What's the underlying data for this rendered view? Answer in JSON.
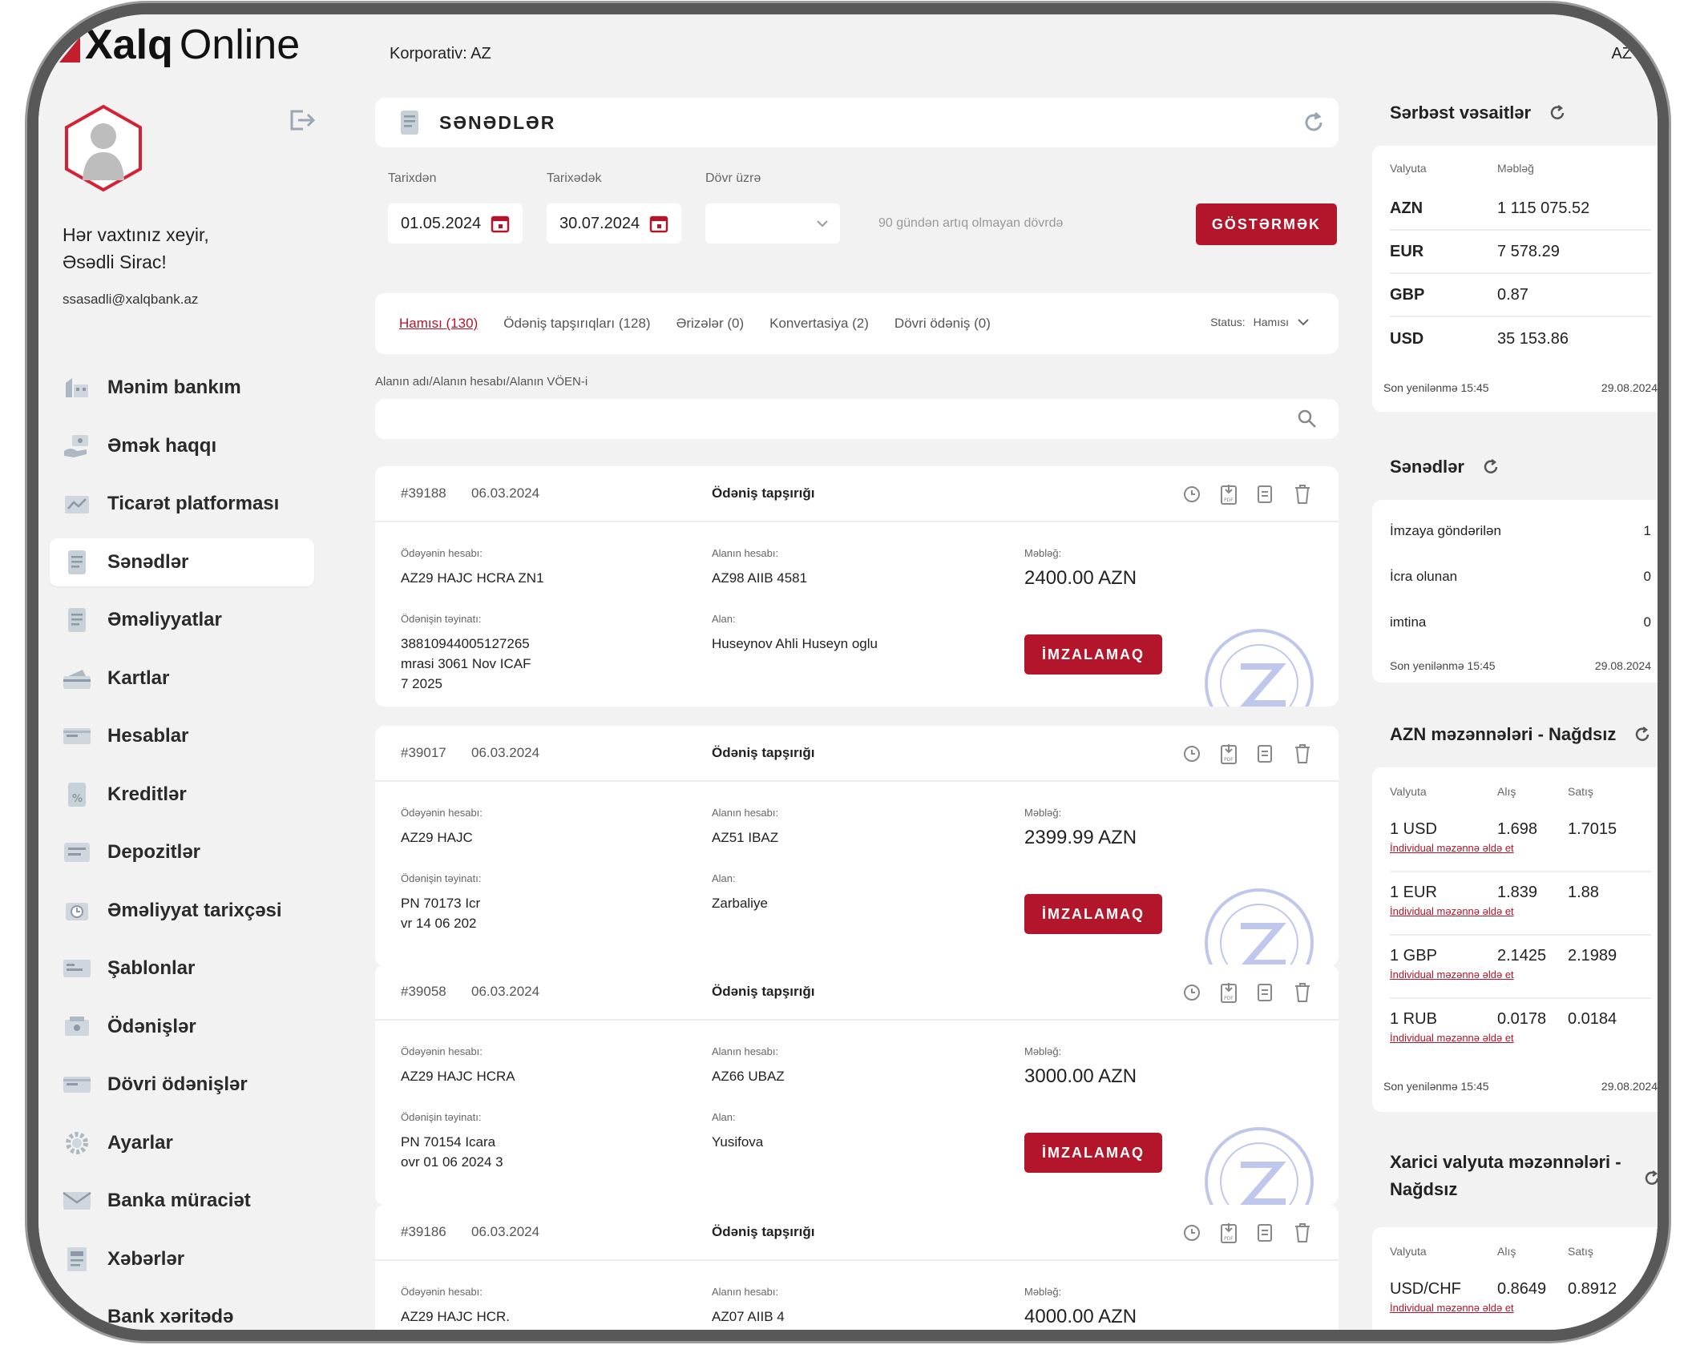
{
  "header": {
    "logo_bold": "Xalq",
    "logo_light": "Online",
    "corporate": "Korporativ: AZ",
    "lang": "AZ"
  },
  "sidebar": {
    "greeting_line1": "Hər vaxtınız xeyir,",
    "greeting_line2": "Əsədli Sirac!",
    "email": "ssasadli@xalqbank.az",
    "items": [
      {
        "label": "Mənim bankım",
        "icon": "bank-icon"
      },
      {
        "label": "Əmək haqqı",
        "icon": "salary-icon"
      },
      {
        "label": "Ticarət platforması",
        "icon": "trade-platform-icon"
      },
      {
        "label": "Sənədlər",
        "icon": "documents-icon"
      },
      {
        "label": "Əməliyyatlar",
        "icon": "operations-icon"
      },
      {
        "label": "Kartlar",
        "icon": "card-icon"
      },
      {
        "label": "Hesablar",
        "icon": "accounts-icon"
      },
      {
        "label": "Kreditlər",
        "icon": "credit-icon"
      },
      {
        "label": "Depozitlər",
        "icon": "deposit-icon"
      },
      {
        "label": "Əməliyyat tarixçəsi",
        "icon": "history-icon"
      },
      {
        "label": "Şablonlar",
        "icon": "template-icon"
      },
      {
        "label": "Ödənişlər",
        "icon": "payment-icon"
      },
      {
        "label": "Dövri ödənişlər",
        "icon": "recurring-payment-icon"
      },
      {
        "label": "Ayarlar",
        "icon": "gear-icon"
      },
      {
        "label": "Banka müraciət",
        "icon": "mail-icon"
      },
      {
        "label": "Xəbərlər",
        "icon": "news-icon"
      },
      {
        "label": "Bank xəritədə",
        "icon": "map-pin-icon"
      }
    ],
    "active_index": 3
  },
  "main": {
    "title": "SƏNƏDLƏR",
    "filters": {
      "from_label": "Tarixdən",
      "from_value": "01.05.2024",
      "to_label": "Tarixədək",
      "to_value": "30.07.2024",
      "period_label": "Dövr üzrə",
      "period_value": "",
      "hint": "90 gündən artıq olmayan dövrdə",
      "show_button": "GÖSTƏRMƏK"
    },
    "tabs": [
      {
        "label": "Hamısı (130)"
      },
      {
        "label": "Ödəniş tapşırıqları (128)"
      },
      {
        "label": "Ərizələr (0)"
      },
      {
        "label": "Konvertasiya (2)"
      },
      {
        "label": "Dövri ödəniş (0)"
      }
    ],
    "status_label": "Status:",
    "status_value": "Hamısı",
    "search_label": "Alanın adı/Alanın hesabı/Alanın VÖEN-i",
    "search_placeholder": "",
    "doc_labels": {
      "payer_account": "Ödəyənin hesabı:",
      "receiver_account": "Alanın hesabı:",
      "amount": "Məbləğ:",
      "purpose": "Ödənişin təyinatı:",
      "receiver": "Alan:",
      "sign": "İMZALAMAQ"
    },
    "documents": [
      {
        "number": "#39188",
        "date": "06.03.2024",
        "type": "Ödəniş tapşırığı",
        "payer_account": "AZ29 HAJC HCRA ZN1",
        "receiver_account": "AZ98 AIIB 4581",
        "amount": "2400.00 AZN",
        "purpose_1": "38810944005127265",
        "purpose_2": "mrasi 3061 Nov ICAF",
        "purpose_3": "7 2025",
        "receiver": "Huseynov Ahli Huseyn oglu"
      },
      {
        "number": "#39017",
        "date": "06.03.2024",
        "type": "Ödəniş tapşırığı",
        "payer_account": "AZ29 HAJC",
        "receiver_account": "AZ51 IBAZ",
        "amount": "2399.99 AZN",
        "purpose_1": "PN 70173 Icr",
        "purpose_2": "vr 14 06 202",
        "purpose_3": "",
        "receiver": "Zarbaliye"
      },
      {
        "number": "#39058",
        "date": "06.03.2024",
        "type": "Ödəniş tapşırığı",
        "payer_account": "AZ29 HAJC HCRA",
        "receiver_account": "AZ66 UBAZ",
        "amount": "3000.00 AZN",
        "purpose_1": "PN 70154 Icara",
        "purpose_2": "ovr 01 06 2024 3",
        "purpose_3": "",
        "receiver": "Yusifova"
      },
      {
        "number": "#39186",
        "date": "06.03.2024",
        "type": "Ödəniş tapşırığı",
        "payer_account": "AZ29 HAJC HCR.",
        "receiver_account": "AZ07 AIIB 4",
        "amount": "4000.00 AZN",
        "purpose_1": "",
        "purpose_2": "",
        "purpose_3": "",
        "receiver": ""
      }
    ]
  },
  "right": {
    "funds": {
      "title": "Sərbəst vəsaitlər",
      "col_currency": "Valyuta",
      "col_amount": "Məbləğ",
      "rows": [
        {
          "currency": "AZN",
          "amount": "1 115 075.52"
        },
        {
          "currency": "EUR",
          "amount": "7 578.29"
        },
        {
          "currency": "GBP",
          "amount": "0.87"
        },
        {
          "currency": "USD",
          "amount": "35 153.86"
        }
      ],
      "updated": "Son yenilənmə 15:45",
      "date": "29.08.2024"
    },
    "docs": {
      "title": "Sənədlər",
      "rows": [
        {
          "label": "İmzaya göndərilən",
          "count": "1"
        },
        {
          "label": "İcra olunan",
          "count": "0"
        },
        {
          "label": "imtina",
          "count": "0"
        }
      ],
      "updated": "Son yenilənmə 15:45",
      "date": "29.08.2024"
    },
    "azn_rates": {
      "title": "AZN məzənnələri - Nağdsız",
      "col_currency": "Valyuta",
      "col_buy": "Alış",
      "col_sell": "Satış",
      "link": "İndividual məzənnə əldə et",
      "rows": [
        {
          "currency": "1 USD",
          "buy": "1.698",
          "sell": "1.7015"
        },
        {
          "currency": "1 EUR",
          "buy": "1.839",
          "sell": "1.88"
        },
        {
          "currency": "1 GBP",
          "buy": "2.1425",
          "sell": "2.1989"
        },
        {
          "currency": "1 RUB",
          "buy": "0.0178",
          "sell": "0.0184"
        }
      ],
      "updated": "Son yenilənmə 15:45",
      "date": "29.08.2024"
    },
    "fx_rates": {
      "title_1": "Xarici valyuta məzənnələri -",
      "title_2": "Nağdsız",
      "col_currency": "Valyuta",
      "col_buy": "Alış",
      "col_sell": "Satış",
      "link": "İndividual məzənnə əldə et",
      "rows": [
        {
          "currency": "USD/CHF",
          "buy": "0.8649",
          "sell": "0.8912"
        }
      ]
    }
  },
  "colors": {
    "accent": "#b3152a",
    "background": "#f2f2f2",
    "card": "#ffffff"
  }
}
